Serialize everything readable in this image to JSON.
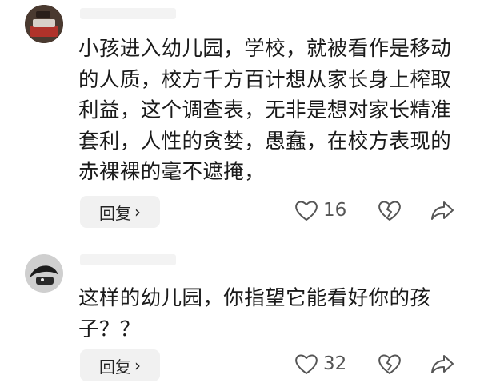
{
  "comments": [
    {
      "username": "",
      "text": "小孩进入幼儿园，学校，就被看作是移动的人质，校方千方百计想从家长身上榨取利益，这个调查表，无非是想对家长精准套利，人性的贪婪，愚蠢，在校方表现的赤裸裸的毫不遮掩，",
      "reply_label": "回复",
      "reply_chevron": "›",
      "likes": "16",
      "icons": {
        "like": "heart-icon",
        "dislike": "broken-heart-icon",
        "share": "share-arrow-icon"
      }
    },
    {
      "username": "",
      "text": "这样的幼儿园，你指望它能看好你的孩子？？",
      "reply_label": "回复",
      "reply_chevron": "›",
      "likes": "32",
      "icons": {
        "like": "heart-icon",
        "dislike": "broken-heart-icon",
        "share": "share-arrow-icon"
      }
    }
  ]
}
